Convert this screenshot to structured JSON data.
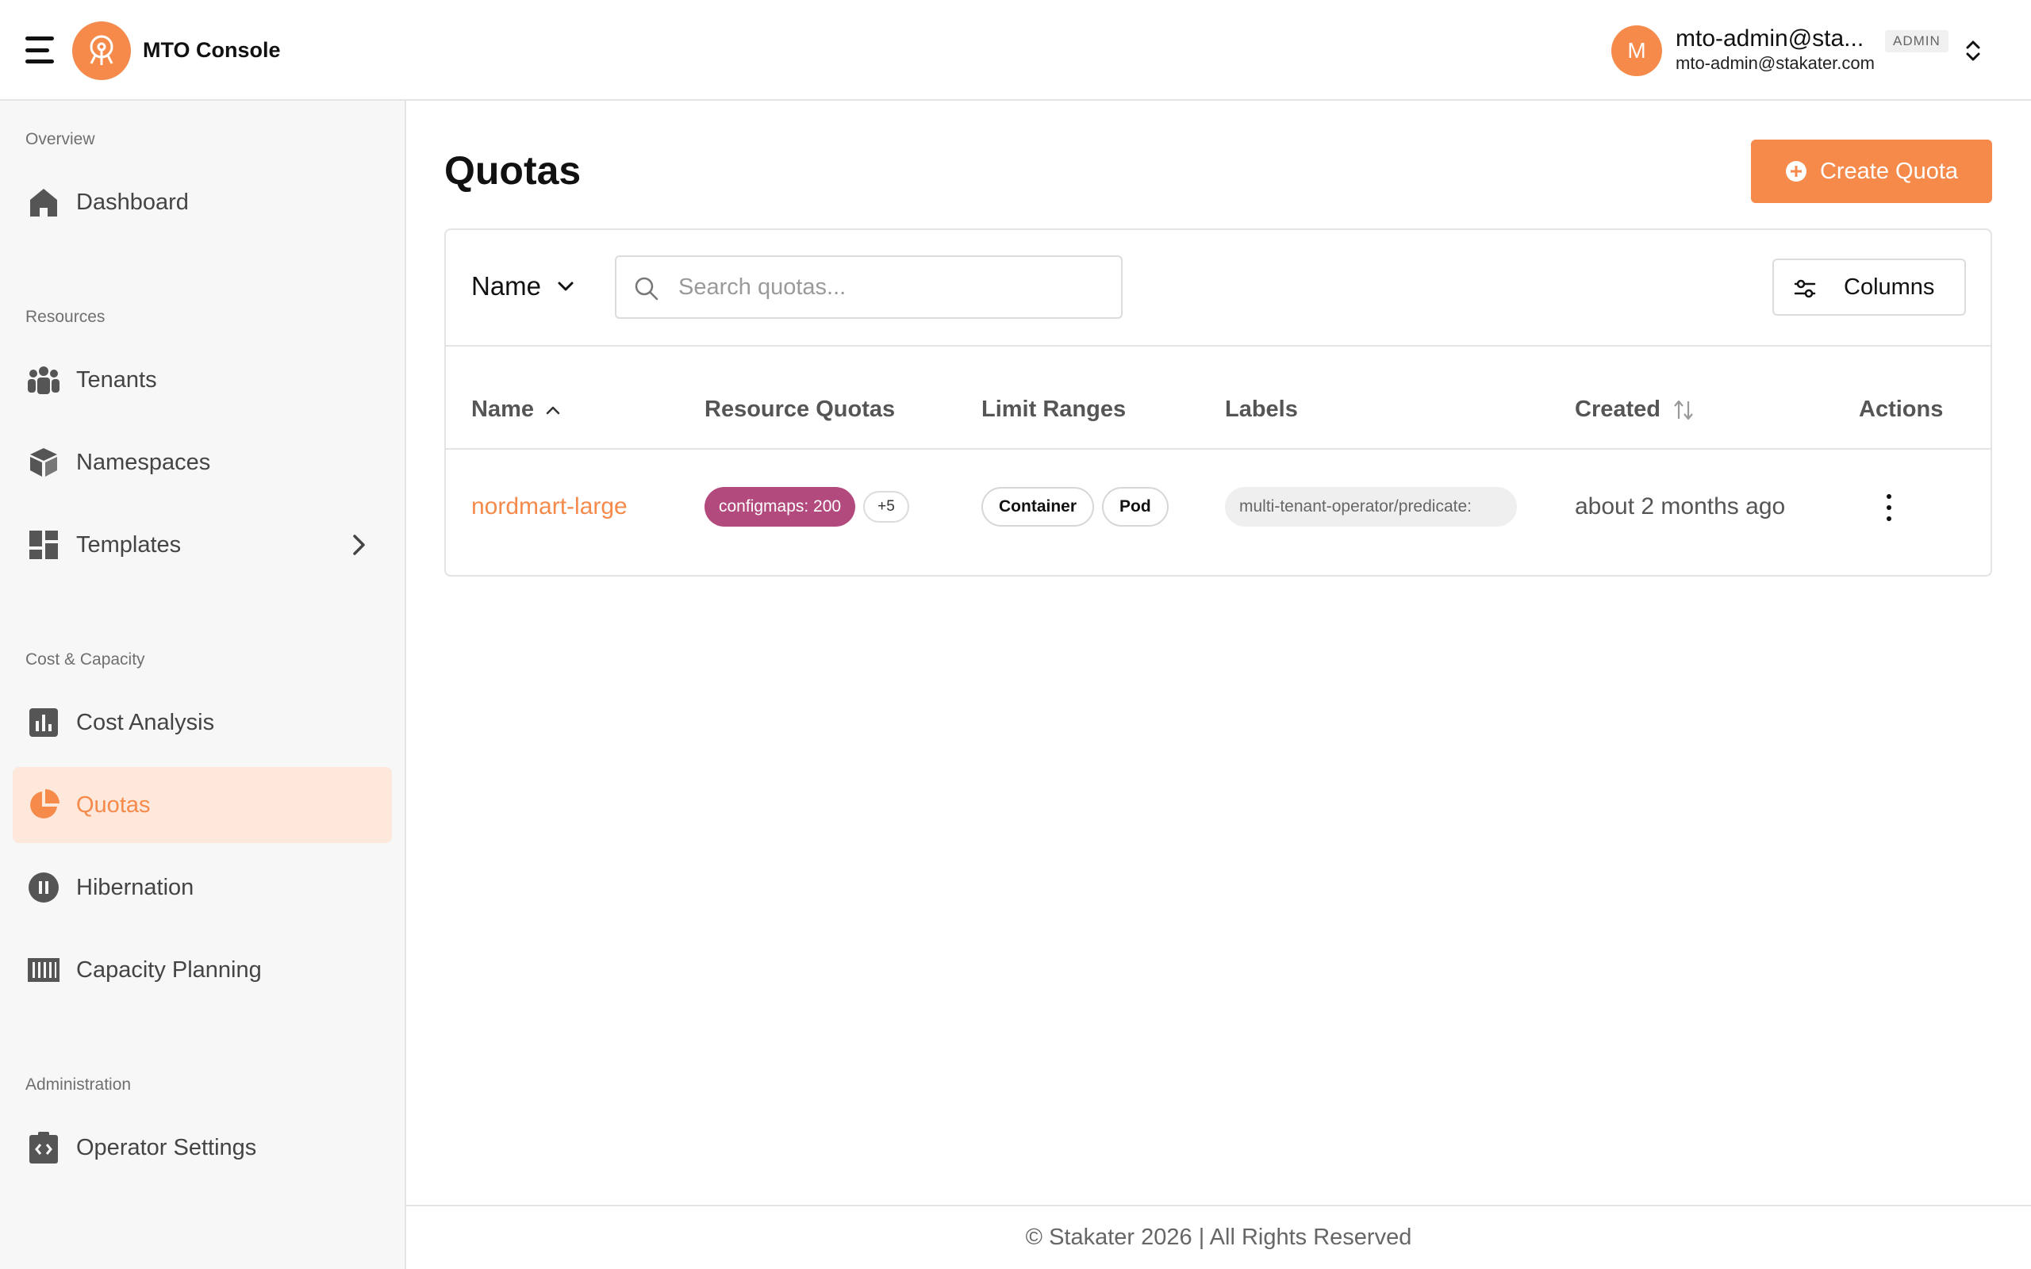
{
  "header": {
    "app_title": "MTO Console",
    "user_initial": "M",
    "user_name": "mto-admin@sta...",
    "user_role": "ADMIN",
    "user_email": "mto-admin@stakater.com"
  },
  "sidebar": {
    "sections": [
      {
        "label": "Overview",
        "items": [
          {
            "label": "Dashboard",
            "icon": "home-icon"
          }
        ]
      },
      {
        "label": "Resources",
        "items": [
          {
            "label": "Tenants",
            "icon": "group-icon"
          },
          {
            "label": "Namespaces",
            "icon": "cube-icon"
          },
          {
            "label": "Templates",
            "icon": "dashboard-grid-icon",
            "has_submenu": true
          }
        ]
      },
      {
        "label": "Cost & Capacity",
        "items": [
          {
            "label": "Cost Analysis",
            "icon": "bar-chart-icon"
          },
          {
            "label": "Quotas",
            "icon": "pie-chart-icon",
            "active": true
          },
          {
            "label": "Hibernation",
            "icon": "pause-circle-icon"
          },
          {
            "label": "Capacity Planning",
            "icon": "barcode-icon"
          }
        ]
      },
      {
        "label": "Administration",
        "items": [
          {
            "label": "Operator Settings",
            "icon": "code-clipboard-icon"
          }
        ]
      }
    ]
  },
  "main": {
    "title": "Quotas",
    "create_button": "Create Quota",
    "filter_field": "Name",
    "search_placeholder": "Search quotas...",
    "columns_button": "Columns",
    "table": {
      "headers": [
        "Name",
        "Resource Quotas",
        "Limit Ranges",
        "Labels",
        "Created",
        "Actions"
      ],
      "rows": [
        {
          "name": "nordmart-large",
          "resource_quota": "configmaps: 200",
          "resource_quota_more": "+5",
          "limit_ranges": [
            "Container",
            "Pod"
          ],
          "label": "multi-tenant-operator/predicate:",
          "created": "about 2 months ago"
        }
      ]
    }
  },
  "footer": {
    "text": "© Stakater 2026 | All Rights Reserved"
  },
  "colors": {
    "accent": "#f58a4b",
    "active_nav_bg": "#fde8db",
    "resource_chip": "#b34a7d"
  }
}
